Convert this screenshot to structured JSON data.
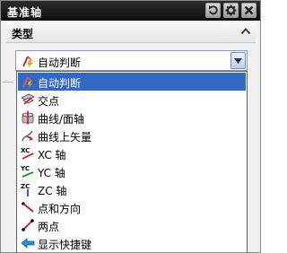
{
  "window": {
    "title": "基准轴"
  },
  "title_buttons": [
    {
      "name": "reset-icon"
    },
    {
      "name": "gear-icon"
    },
    {
      "name": "close-icon"
    }
  ],
  "section": {
    "title": "类型"
  },
  "combo": {
    "value": "自动判断",
    "icon": "auto-infer-icon"
  },
  "dropdown": {
    "selected_index": 0,
    "items": [
      {
        "label": "自动判断",
        "icon": "auto-infer-icon"
      },
      {
        "label": "交点",
        "icon": "intersection-icon"
      },
      {
        "label": "曲线/面轴",
        "icon": "curve-face-axis-icon"
      },
      {
        "label": "曲线上矢量",
        "icon": "curve-vector-icon"
      },
      {
        "label": "XC 轴",
        "icon": "xc-axis-icon",
        "icon_text": "XC"
      },
      {
        "label": "YC 轴",
        "icon": "yc-axis-icon",
        "icon_text": "YC"
      },
      {
        "label": "ZC 轴",
        "icon": "zc-axis-icon",
        "icon_text": "ZC"
      },
      {
        "label": "点和方向",
        "icon": "point-direction-icon"
      },
      {
        "label": "两点",
        "icon": "two-points-icon"
      },
      {
        "label": "显示快捷键",
        "icon": "show-shortcuts-icon"
      }
    ]
  },
  "colors": {
    "title_bg": "#111111",
    "selection": "#3169c6",
    "accent_red": "#d01818"
  }
}
